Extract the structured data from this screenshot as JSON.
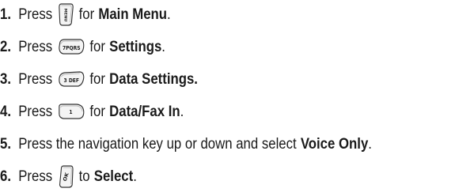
{
  "steps": [
    {
      "number": "1.",
      "before": "Press",
      "key_icon": "menu-key-icon",
      "key_label": "MENU",
      "after": "for",
      "bold": "Main Menu",
      "end": "."
    },
    {
      "number": "2.",
      "before": "Press",
      "key_icon": "key-7pqrs-icon",
      "key_label": "7PQRS",
      "after": "for",
      "bold": "Settings",
      "end": "."
    },
    {
      "number": "3.",
      "before": "Press",
      "key_icon": "key-3def-icon",
      "key_label": "3 DEF",
      "after": "for",
      "bold": "Data Settings.",
      "end": ""
    },
    {
      "number": "4.",
      "before": "Press",
      "key_icon": "key-1-icon",
      "key_label": "1",
      "after": "for",
      "bold": "Data/Fax In",
      "end": "."
    },
    {
      "number": "5.",
      "before": "Press the navigation key up or down and select",
      "bold": "Voice Only",
      "end": "."
    },
    {
      "number": "6.",
      "before": "Press",
      "key_icon": "ok-key-icon",
      "key_label": "OK",
      "after": "to",
      "bold": "Select",
      "end": "."
    }
  ]
}
